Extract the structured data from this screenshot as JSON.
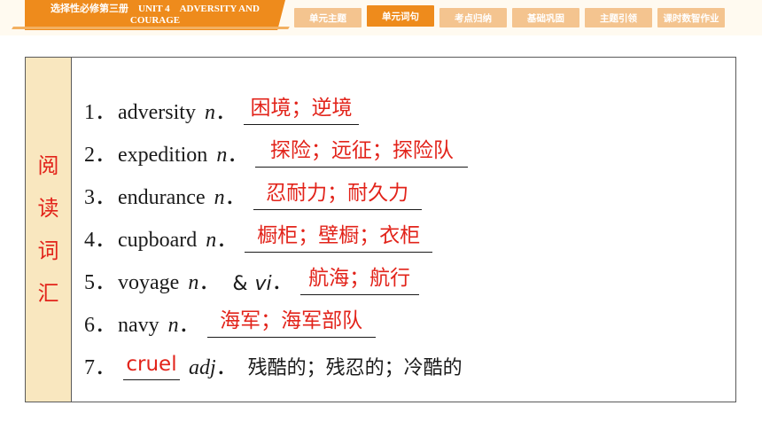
{
  "header": {
    "title": "选择性必修第三册　UNIT 4　ADVERSITY AND COURAGE",
    "tabs": [
      {
        "label": "单元主题",
        "active": false
      },
      {
        "label": "单元词句",
        "active": true
      },
      {
        "label": "考点归纳",
        "active": false
      },
      {
        "label": "基础巩固",
        "active": false
      },
      {
        "label": "主题引领",
        "active": false
      },
      {
        "label": "课时数智作业",
        "active": false
      }
    ]
  },
  "section": {
    "label_chars": [
      "阅",
      "读",
      "词",
      "汇"
    ]
  },
  "vocab": [
    {
      "num": "1．",
      "word": "adversity",
      "pos": "n",
      "answer": "困境；逆境"
    },
    {
      "num": "2．",
      "word": "expedition",
      "pos": "n",
      "answer": "探险；远征；探险队"
    },
    {
      "num": "3．",
      "word": "endurance",
      "pos": "n",
      "answer": "忍耐力；耐久力"
    },
    {
      "num": "4．",
      "word": "cupboard",
      "pos": "n",
      "answer": "橱柜；壁橱；衣柜"
    },
    {
      "num": "5．",
      "word": "voyage",
      "pos": "n",
      "amp": "&",
      "pos2": "vi",
      "answer": "航海；航行"
    },
    {
      "num": "6．",
      "word": "navy",
      "pos": "n",
      "answer": "海军；海军部队"
    },
    {
      "num": "7．",
      "answer": "cruel",
      "pos": "adj",
      "meaning": "残酷的；残忍的；冷酷的"
    }
  ]
}
